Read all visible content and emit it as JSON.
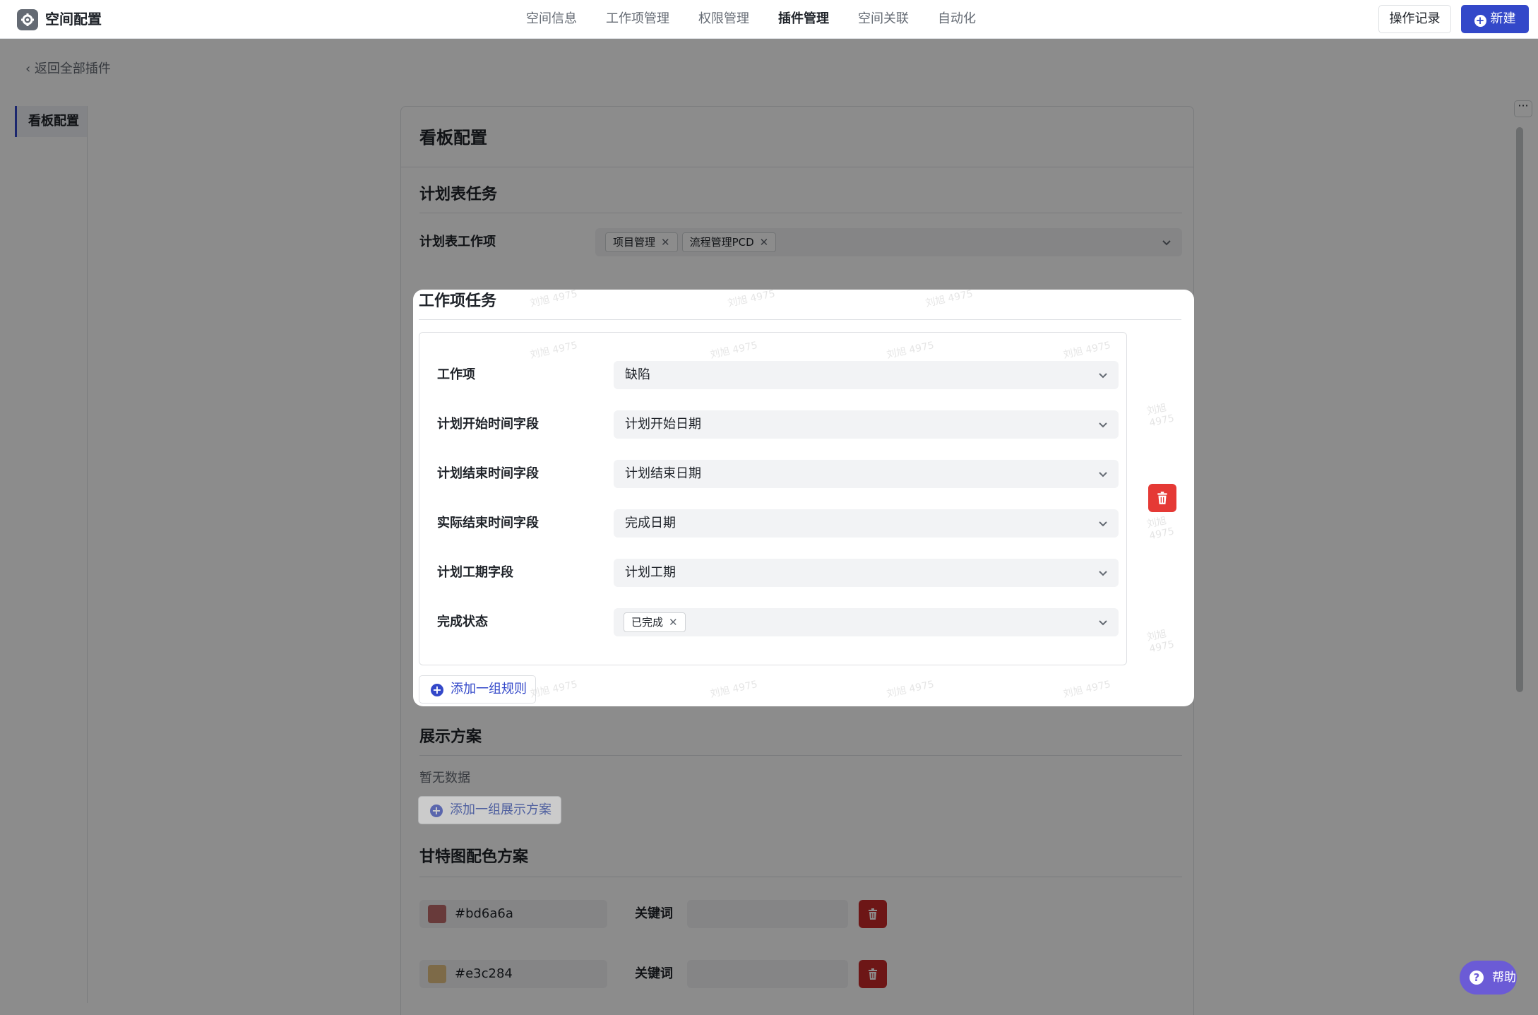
{
  "app": {
    "title": "空间配置",
    "logo_icon": "gear-icon"
  },
  "nav": {
    "items": [
      {
        "label": "空间信息",
        "active": false
      },
      {
        "label": "工作项管理",
        "active": false
      },
      {
        "label": "权限管理",
        "active": false
      },
      {
        "label": "插件管理",
        "active": true
      },
      {
        "label": "空间关联",
        "active": false
      },
      {
        "label": "自动化",
        "active": false
      }
    ]
  },
  "toolbar": {
    "log_label": "操作记录",
    "new_label": "新建",
    "new_icon": "plus-circle-icon"
  },
  "back_link": "返回全部插件",
  "sidebar": {
    "items": [
      {
        "label": "看板配置",
        "active": true
      }
    ]
  },
  "card": {
    "title": "看板配置"
  },
  "plan_tasks": {
    "title": "计划表任务",
    "field_label": "计划表工作项",
    "tags": [
      "项目管理",
      "流程管理PCD"
    ]
  },
  "work_tasks": {
    "title": "工作项任务",
    "rules": [
      {
        "label": "工作项",
        "value": "缺陷"
      },
      {
        "label": "计划开始时间字段",
        "value": "计划开始日期"
      },
      {
        "label": "计划结束时间字段",
        "value": "计划结束日期"
      },
      {
        "label": "实际结束时间字段",
        "value": "完成日期"
      },
      {
        "label": "计划工期字段",
        "value": "计划工期"
      }
    ],
    "status_label": "完成状态",
    "status_tags": [
      "已完成"
    ],
    "add_rule_label": "添加一组规则"
  },
  "display_plan": {
    "title": "展示方案",
    "empty_text": "暂无数据",
    "add_label": "添加一组展示方案"
  },
  "gantt_colors": {
    "title": "甘特图配色方案",
    "keyword_label": "关键词",
    "schemes": [
      {
        "color": "#bd6a6a",
        "keyword": ""
      },
      {
        "color": "#e3c284",
        "keyword": ""
      }
    ]
  },
  "watermark": "刘旭 4975",
  "help_label": "帮助",
  "colors": {
    "accent": "#3348c9",
    "danger": "#e53935"
  }
}
